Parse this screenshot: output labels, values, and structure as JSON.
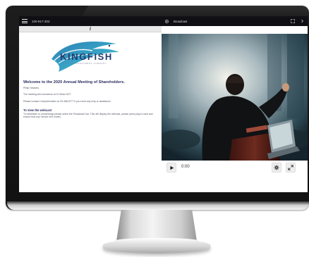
{
  "left": {
    "meeting_code": "100-817-303",
    "info_icon": "i",
    "logo": {
      "name": "KINGFISH",
      "tagline": "LISTED INVESTMENT COMPANY"
    },
    "welcome_title": "Welcome to the 2020 Annual Meeting of Shareholders.",
    "chair_name": "Philip Hawkins",
    "commence_text": "The meeting will commence at 10.30am NZT",
    "contact_text": "Please contact Computershare on 09-488-8777 if you need any help or assistance.",
    "webcast_heading": "To view the webcast",
    "webcast_body": "To view/listen to proceedings please select the 'Broadcast' bar. This will display the webcast, please press play to start and ensure that your device isn't muted."
  },
  "right": {
    "broadcast_label": "Broadcast",
    "time": "0:00"
  },
  "icons": {
    "menu": "hamburger-icon",
    "broadcast": "broadcast-icon",
    "expand": "expand-icon",
    "next": "chevron-right-icon",
    "play": "play-icon",
    "settings": "gear-icon",
    "fullscreen": "fullscreen-icon"
  },
  "colors": {
    "topbar": "#101014",
    "heading": "#2a2f5f",
    "logo_text": "#233a6e"
  }
}
